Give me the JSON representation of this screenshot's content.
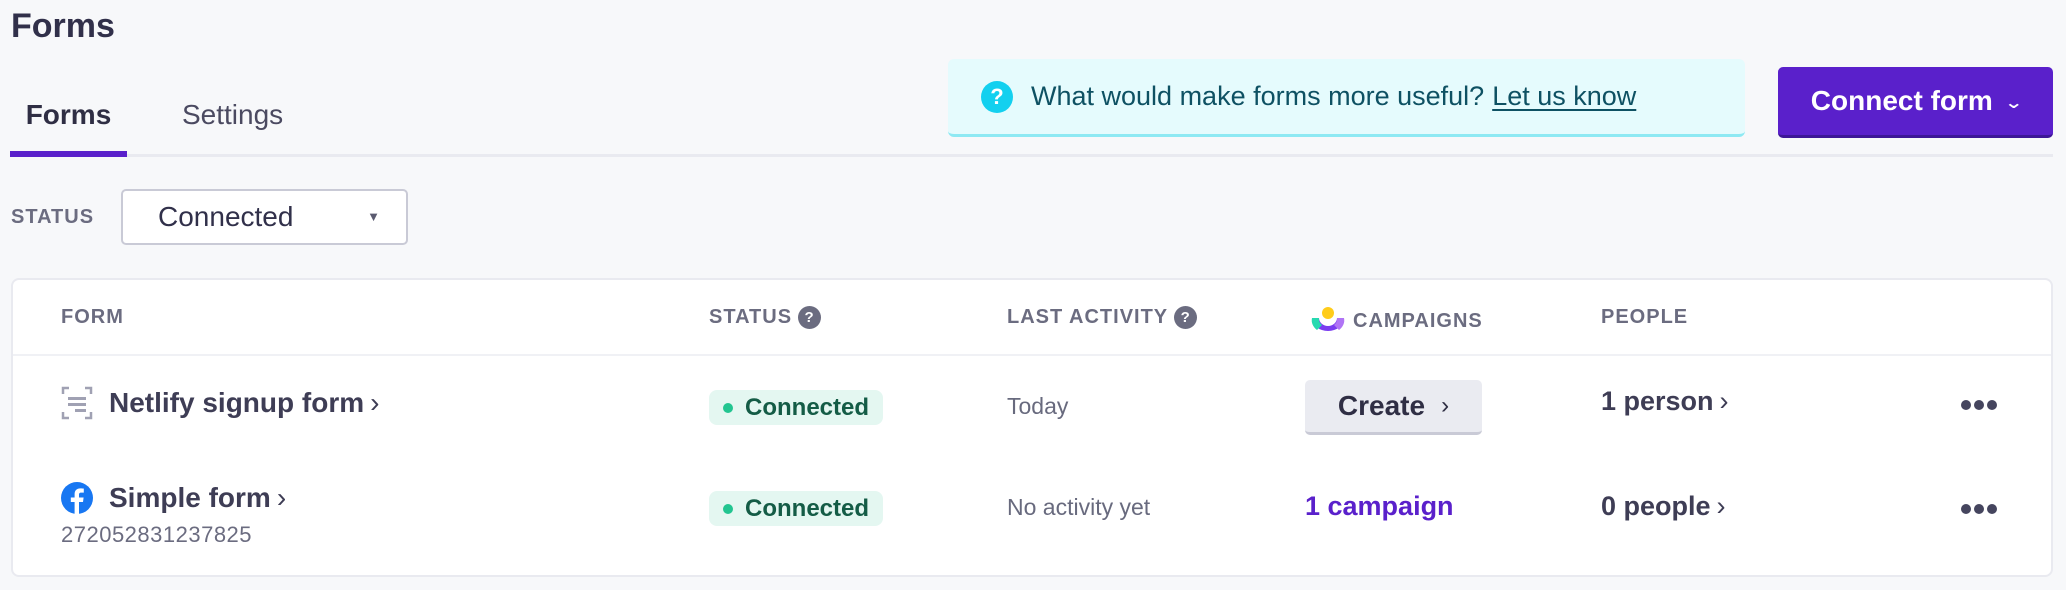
{
  "page": {
    "title": "Forms"
  },
  "tabs": [
    {
      "label": "Forms",
      "active": true
    },
    {
      "label": "Settings",
      "active": false
    }
  ],
  "banner": {
    "icon": "question-circle-icon",
    "text": "What would make forms more useful?",
    "link_label": "Let us know"
  },
  "connect_button": {
    "label": "Connect form",
    "icon": "chevron-down-icon"
  },
  "filter": {
    "label": "STATUS",
    "selected": "Connected",
    "caret": "▼"
  },
  "table": {
    "headers": {
      "form": "FORM",
      "status": "STATUS",
      "last_activity": "LAST ACTIVITY",
      "campaigns": "CAMPAIGNS",
      "people": "PEOPLE"
    },
    "help_glyph": "?",
    "rows": [
      {
        "icon": "form-scan-icon",
        "name": "Netlify signup form",
        "arrow": "›",
        "id": "",
        "status": "Connected",
        "last_activity": "Today",
        "campaign_action": "Create",
        "campaign_arrow": "›",
        "people": "1 person",
        "people_arrow": "›"
      },
      {
        "icon": "facebook-icon",
        "name": "Simple form",
        "arrow": "›",
        "id": "272052831237825",
        "status": "Connected",
        "last_activity": "No activity yet",
        "campaign_link": "1 campaign",
        "people": "0 people",
        "people_arrow": "›"
      }
    ]
  },
  "colors": {
    "accent": "#5a20cb",
    "connected_badge_bg": "#e4f7f1",
    "connected_dot": "#22c590",
    "banner_bg": "#e5fbfd",
    "facebook_blue": "#1877f2"
  }
}
